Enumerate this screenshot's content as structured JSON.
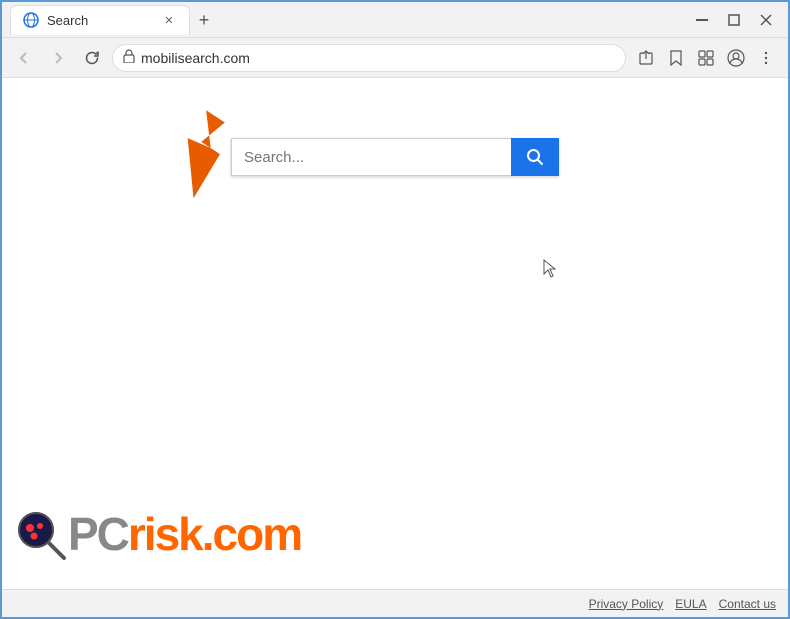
{
  "window": {
    "title": "Search",
    "url": "mobilisearch.com",
    "tab_label": "Search",
    "new_tab_label": "+",
    "minimize": "—",
    "restore": "☐",
    "close": "✕"
  },
  "nav": {
    "back_title": "Back",
    "forward_title": "Forward",
    "refresh_title": "Refresh",
    "lock_symbol": "🔒",
    "share_symbol": "⎙",
    "bookmark_symbol": "☆",
    "extension_symbol": "□",
    "profile_symbol": "◉",
    "menu_symbol": "⋮"
  },
  "search": {
    "placeholder": "Search...",
    "button_title": "Search"
  },
  "footer": {
    "privacy_policy": "Privacy Policy",
    "eula": "EULA",
    "contact_us": "Contact us"
  },
  "logo": {
    "pc": "PC",
    "risk": "risk",
    "dotcom": ".com"
  }
}
